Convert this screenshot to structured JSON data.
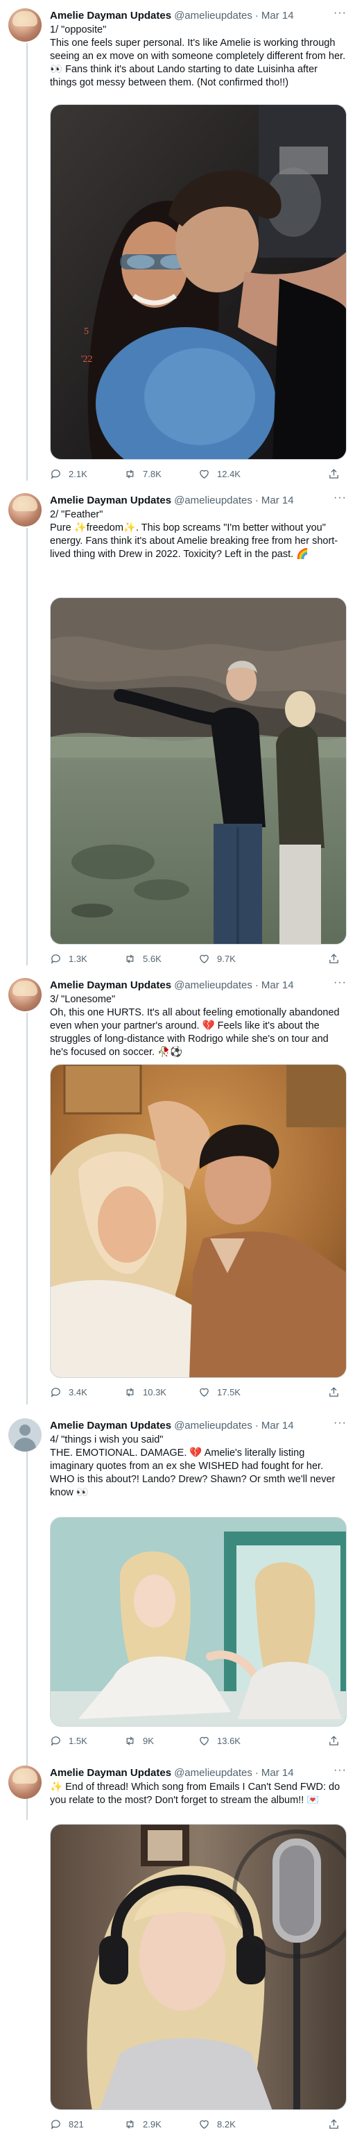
{
  "account": {
    "name": "Amelie Dayman Updates",
    "handle": "@amelieupdates",
    "dot": "·"
  },
  "tweets": [
    {
      "date": "Mar 14",
      "text": "1/ \"opposite\"\nThis one feels super personal. It's like Amelie is working through seeing an ex move on with someone completely different from her. 👀 Fans think it's about Lando starting to date Luisinha after things got messy between them. (Not confirmed tho!!)",
      "replies": "2.1K",
      "retweets": "7.8K",
      "likes": "12.4K",
      "photo_caption": "5\n'22"
    },
    {
      "date": "Mar 14",
      "text": "2/ \"Feather\"\nPure ✨freedom✨. This bop screams \"I'm better without you\" energy. Fans think it's about Amelie breaking free from her short-lived thing with Drew in 2022. Toxicity? Left in the past. 🌈",
      "replies": "1.3K",
      "retweets": "5.6K",
      "likes": "9.7K"
    },
    {
      "date": "Mar 14",
      "text": "3/ \"Lonesome\"\nOh, this one HURTS. It's all about feeling emotionally abandoned even when your partner's around. 💔 Feels like it's about the struggles of long-distance with Rodrigo while she's on tour and he's focused on soccer. 🥀⚽",
      "replies": "3.4K",
      "retweets": "10.3K",
      "likes": "17.5K"
    },
    {
      "date": "Mar 14",
      "text": "4/ \"things i wish you said\"\nTHE. EMOTIONAL. DAMAGE. 💔 Amelie's literally listing imaginary quotes from an ex she WISHED had fought for her. WHO is this about?! Lando? Drew? Shawn? Or smth we'll never know 👀",
      "replies": "1.5K",
      "retweets": "9K",
      "likes": "13.6K"
    },
    {
      "date": "Mar 14",
      "text": "✨ End of thread! Which song from Emails I Can't Send FWD: do you relate to the most? Don't forget to stream the album!! 💌",
      "replies": "821",
      "retweets": "2.9K",
      "likes": "8.2K"
    }
  ],
  "icons": {
    "reply": "reply-icon",
    "retweet": "retweet-icon",
    "like": "heart-icon",
    "share": "share-icon",
    "more": "more-icon"
  },
  "more_glyph": "···"
}
